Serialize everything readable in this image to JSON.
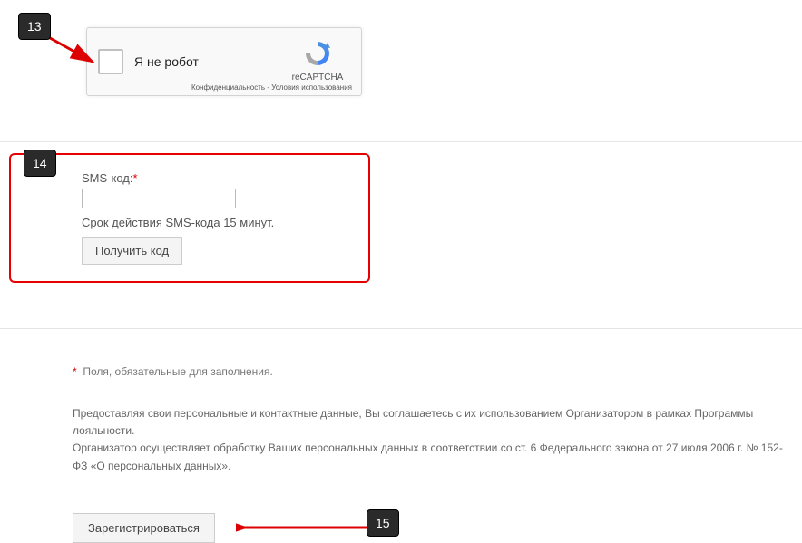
{
  "annotations": {
    "badge13": "13",
    "badge14": "14",
    "badge15": "15"
  },
  "recaptcha": {
    "label": "Я не робот",
    "brand": "reCAPTCHA",
    "privacy": "Конфиденциальность",
    "terms": "Условия использования",
    "separator": " - "
  },
  "sms": {
    "label": "SMS-код:",
    "hint": "Срок действия SMS-кода 15 минут.",
    "get_code": "Получить код"
  },
  "footer": {
    "required_note": "Поля, обязательные для заполнения.",
    "legal1": "Предоставляя свои персональные и контактные данные, Вы соглашаетесь с их использованием Организатором в рамках Программы лояльности.",
    "legal2": "Организатор осуществляет обработку Ваших персональных данных в соответствии со ст. 6 Федерального закона от 27 июля 2006 г. № 152-ФЗ «О персональных данных».",
    "register": "Зарегистрироваться"
  }
}
